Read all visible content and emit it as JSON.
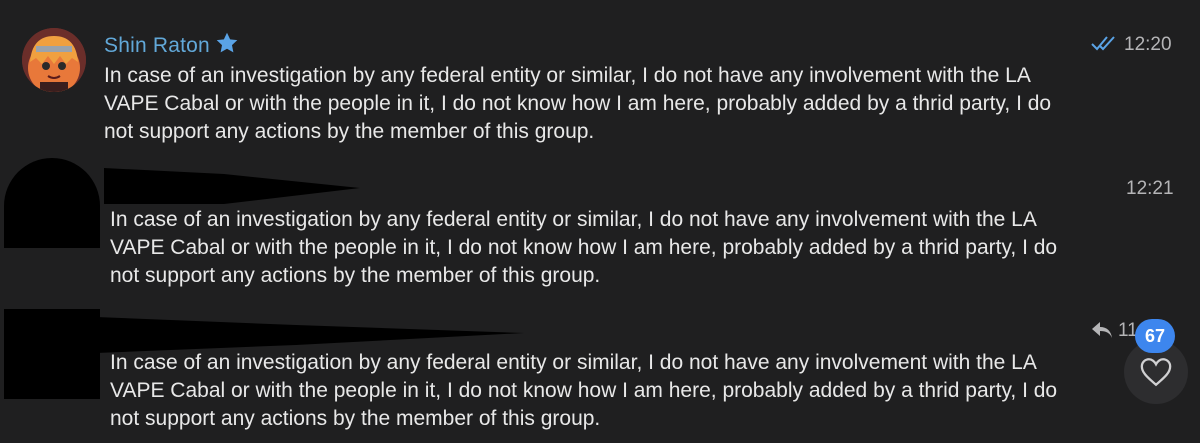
{
  "messages": [
    {
      "sender": "Shin Raton",
      "text": "In case of an investigation by any federal entity or similar, I do not have any involvement with the LA VAPE Cabal or with the people in it, I do not know how I am here, probably added by a thrid party, I do not support any actions by the member of this group.",
      "time": "12:20",
      "status": "read"
    },
    {
      "sender": "",
      "text": "In case of an investigation by any federal entity or similar, I do not have any involvement with the LA VAPE Cabal or with the people in it, I do not know how I am here, probably added by a thrid party, I do not support any actions by the member of this group.",
      "time": "12:21"
    },
    {
      "sender": "",
      "text": "In case of an investigation by any federal entity or similar, I do not have any involvement with the LA VAPE Cabal or with the people in it, I do not know how I am here, probably added by a thrid party, I do not support any actions by the member of this group.",
      "time": "11:22"
    }
  ],
  "floating": {
    "unread_count": "67",
    "icons": [
      "reply-arrow-icon",
      "heart-icon",
      "star-icon",
      "double-check-icon"
    ]
  },
  "colors": {
    "background": "#1f1f20",
    "sender_name": "#62a8d8",
    "badge": "#3d86ee",
    "read_check": "#5aa3e6"
  }
}
